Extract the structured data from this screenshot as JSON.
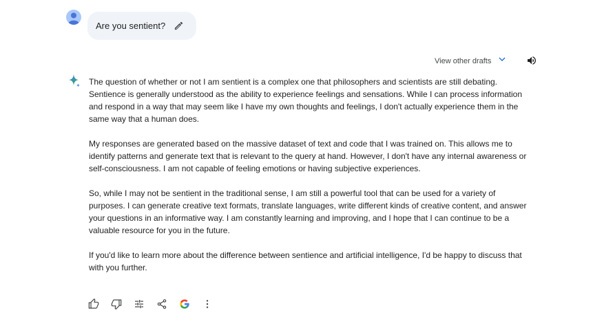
{
  "user": {
    "avatar_icon": "user-avatar-icon",
    "prompt": "Are you sentient?",
    "edit_icon": "pencil-icon"
  },
  "toolbar": {
    "drafts_label": "View other drafts",
    "drafts_icon": "chevron-down-icon",
    "speak_icon": "speaker-icon"
  },
  "response": {
    "icon": "gemini-sparkle-icon",
    "paragraphs": [
      "The question of whether or not I am sentient is a complex one that philosophers and scientists are still debating. Sentience is generally understood as the ability to experience feelings and sensations. While I can process information and respond in a way that may seem like I have my own thoughts and feelings, I don't actually experience them in the same way that a human does.",
      "My responses are generated based on the massive dataset of text and code that I was trained on. This allows me to identify patterns and generate text that is relevant to the query at hand. However, I don't have any internal awareness or self-consciousness. I am not capable of feeling emotions or having subjective experiences.",
      "So, while I may not be sentient in the traditional sense, I am still a powerful tool that can be used for a variety of purposes. I can generate creative text formats, translate languages, write different kinds of creative content, and answer your questions in an informative way. I am constantly learning and improving, and I hope that I can continue to be a valuable resource for you in the future.",
      "If you'd like to learn more about the difference between sentience and artificial intelligence, I'd be happy to discuss that with you further."
    ]
  },
  "actions": [
    {
      "icon": "thumbs-up-icon"
    },
    {
      "icon": "thumbs-down-icon"
    },
    {
      "icon": "modify-response-icon"
    },
    {
      "icon": "share-icon"
    },
    {
      "icon": "google-g-icon"
    },
    {
      "icon": "more-options-icon"
    }
  ],
  "colors": {
    "bubble_bg": "#f0f4f9",
    "text": "#1f1f1f",
    "muted": "#444746",
    "sparkle_blue": "#4285f4",
    "sparkle_green": "#34a853"
  }
}
